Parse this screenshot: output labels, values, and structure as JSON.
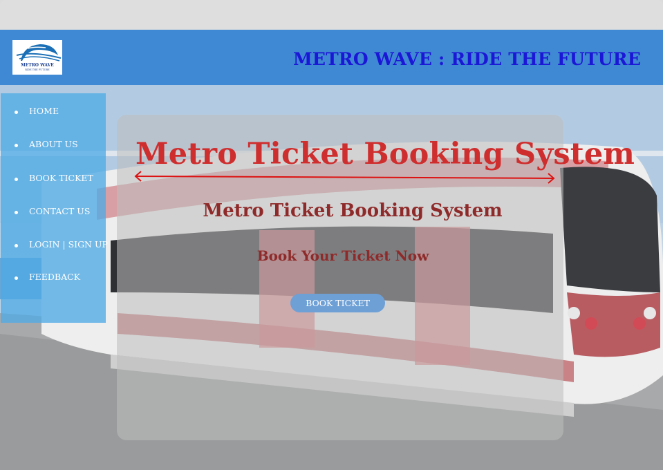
{
  "logo": {
    "line1": "METRO WAVE",
    "line2": "RIDE THE FUTURE"
  },
  "header": {
    "title": "METRO WAVE : RIDE THE FUTURE"
  },
  "sidebar": {
    "items": [
      {
        "label": "HOME"
      },
      {
        "label": "ABOUT US"
      },
      {
        "label": "BOOK TICKET"
      },
      {
        "label": "CONTACT US"
      },
      {
        "label": "LOGIN | SIGN UP"
      },
      {
        "label": "FEEDBACK"
      }
    ]
  },
  "hero": {
    "title": "Metro Ticket Booking System",
    "subtitle": "Metro Ticket Booking System",
    "cta_text": "Book Your Ticket Now",
    "button_label": "BOOK TICKET"
  },
  "colors": {
    "header_bg": "#3f88d3",
    "header_title": "#1b17d6",
    "sidebar_bg": "#50aae6",
    "hero_title": "#cf2e2e",
    "hero_text": "#8f2a2a",
    "button_bg": "#6ea0d6"
  },
  "icons": [
    "metro-wave-logo",
    "double-headed-arrow-icon",
    "bullet-dot-icon"
  ]
}
